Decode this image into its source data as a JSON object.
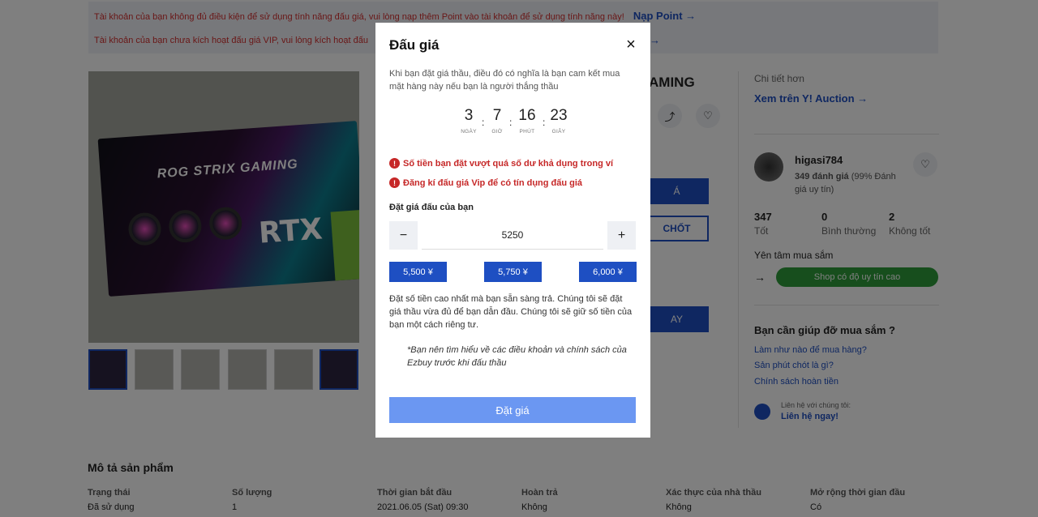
{
  "alerts": {
    "line1": "Tài khoản của bạn không đủ điều kiện để sử dụng tính năng đấu giá, vui lòng nạp thêm Point vào tài khoản để sử dụng tính năng này!",
    "line1_link": "Nạp Point →",
    "line2": "Tài khoản của bạn chưa kích hoạt đấu giá VIP, vui lòng kích hoạt đấu",
    "line2_link": "→"
  },
  "product": {
    "title_fragment": "AMING",
    "image_texts": {
      "brand": "ROG STRIX GAMING",
      "rtx": "RTX"
    },
    "buttons": {
      "b1": "Á",
      "b2": "CHỐT",
      "b3": "AY"
    },
    "share_icon": "share-icon",
    "heart_icon": "heart-icon"
  },
  "sidebar": {
    "more_detail": "Chi tiết hơn",
    "view_on_yahoo": "Xem trên Y! Auction →",
    "seller_name": "higasi784",
    "seller_reviews_bold": "349 đánh giá",
    "seller_reviews_rest": " (99% Đánh giá uy tín)",
    "stats": [
      {
        "num": "347",
        "label": "Tốt"
      },
      {
        "num": "0",
        "label": "Bình thường"
      },
      {
        "num": "2",
        "label": "Không tốt"
      }
    ],
    "peace_of_mind": "Yên tâm mua sắm",
    "arrow": "→",
    "trusted_badge": "Shop có độ uy tín cao",
    "help_title": "Bạn cần giúp đỡ mua sắm ?",
    "help_links": [
      "Làm như nào để mua hàng?",
      "Sản phút chót là gì?",
      "Chính sách hoàn tiền"
    ],
    "contact_small": "Liên hệ với chúng tôi:",
    "contact_link": "Liên hệ ngay!"
  },
  "description": {
    "title": "Mô tả sản phẩm",
    "columns": [
      {
        "header": "Trạng thái",
        "value": "Đã sử dụng"
      },
      {
        "header": "Số lượng",
        "value": "1"
      },
      {
        "header": "Thời gian bắt đầu",
        "value": "2021.06.05 (Sat) 09:30"
      },
      {
        "header": "Hoàn trả",
        "value": "Không"
      },
      {
        "header": "Xác thực của nhà thầu",
        "value": "Không"
      },
      {
        "header": "Mở rộng thời gian đầu",
        "value": "Có"
      }
    ]
  },
  "modal": {
    "title": "Đấu giá",
    "close": "×",
    "intro": "Khi bạn đặt giá thầu, điều đó có nghĩa là bạn cam kết mua mặt hàng này nếu bạn là người thắng thầu",
    "countdown": [
      {
        "num": "3",
        "label": "NGÀY"
      },
      {
        "num": "7",
        "label": "GIỜ"
      },
      {
        "num": "16",
        "label": "PHÚT"
      },
      {
        "num": "23",
        "label": "GIÂY"
      }
    ],
    "separator": ":",
    "warnings": [
      "Số tiền bạn đặt vượt quá số dư khả dụng trong ví",
      "Đăng kí đấu giá Vip để có tín dụng đấu giá"
    ],
    "bid_label": "Đặt giá đấu của bạn",
    "minus": "−",
    "plus": "+",
    "bid_value": "5250",
    "quick_bids": [
      "5,500 ¥",
      "5,750 ¥",
      "6,000 ¥"
    ],
    "note": "Đặt số tiền cao nhất mà bạn sẵn sàng trả. Chúng tôi sẽ đặt giá thầu vừa đủ để bạn dẫn đầu. Chúng tôi sẽ giữ số tiền của bạn một cách riêng tư.",
    "italic_note": "*Bạn nên tìm hiểu về các điều khoản và chính sách của Ezbuy trước khi đấu thầu",
    "submit": "Đặt giá"
  }
}
